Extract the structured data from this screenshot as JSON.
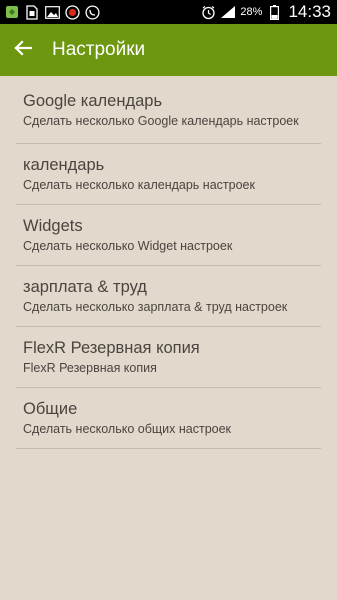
{
  "status_bar": {
    "battery_percent": "28%",
    "time": "14:33",
    "left_icons": [
      "app-notification-icon",
      "sim-icon",
      "gallery-icon",
      "record-icon",
      "whatsapp-icon"
    ],
    "right_icons": [
      "alarm-icon",
      "signal-icon",
      "battery-icon"
    ]
  },
  "app_bar": {
    "title": "Настройки",
    "background": "#6c970f"
  },
  "settings": [
    {
      "title": "Google календарь",
      "subtitle": "Сделать несколько Google календарь настроек"
    },
    {
      "title": "календарь",
      "subtitle": "Сделать несколько календарь настроек"
    },
    {
      "title": "Widgets",
      "subtitle": "Сделать несколько Widget настроек"
    },
    {
      "title": "зарплата & труд",
      "subtitle": "Сделать несколько зарплата & труд настроек"
    },
    {
      "title": "FlexR Резервная копия",
      "subtitle": "FlexR Резервная копия"
    },
    {
      "title": "Общие",
      "subtitle": "Сделать несколько общих настроек"
    }
  ]
}
